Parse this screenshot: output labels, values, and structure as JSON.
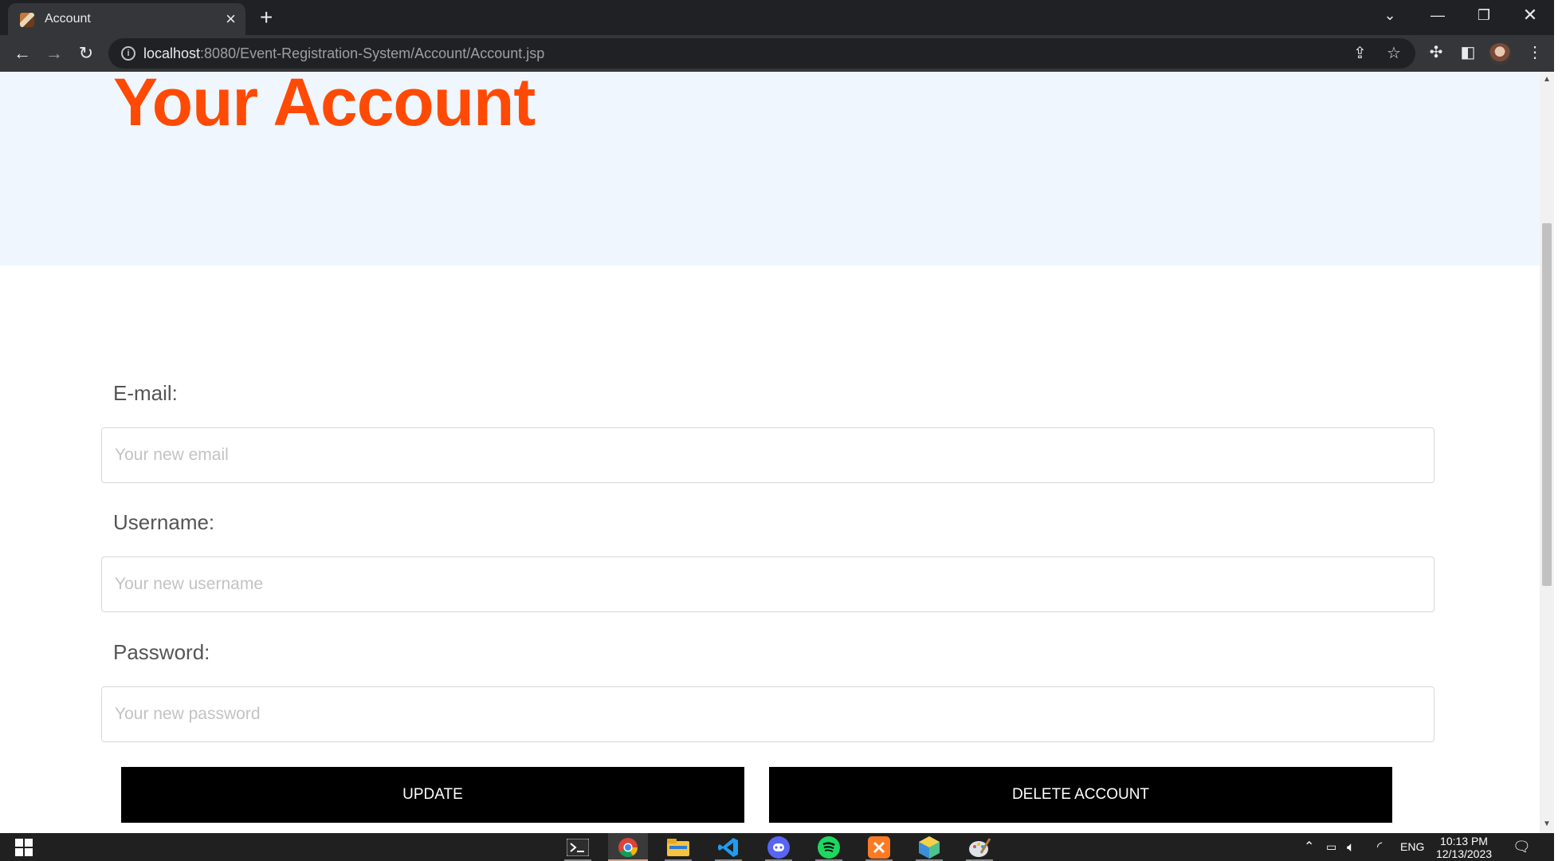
{
  "browser": {
    "tab_title": "Account",
    "new_tab_symbol": "+",
    "url_host": "localhost",
    "url_rest": ":8080/Event-Registration-System/Account/Account.jsp"
  },
  "page": {
    "heading": "Your Account",
    "email": {
      "label": "E-mail:",
      "placeholder": "Your new email",
      "value": ""
    },
    "username": {
      "label": "Username:",
      "placeholder": "Your new username",
      "value": ""
    },
    "password": {
      "label": "Password:",
      "placeholder": "Your new password",
      "value": ""
    },
    "update_button": "UPDATE",
    "delete_button": "DELETE ACCOUNT"
  },
  "taskbar": {
    "apps": [
      "terminal-icon",
      "chrome-icon",
      "file-explorer-icon",
      "vscode-icon",
      "discord-icon",
      "spotify-icon",
      "xampp-icon",
      "app-icon",
      "paint-icon"
    ],
    "language": "ENG",
    "time": "10:13 PM",
    "date": "12/13/2023"
  },
  "colors": {
    "heading": "#ff4a05",
    "hero_background": "#eff6fd",
    "button_background": "#000000",
    "chrome_dark": "#202124"
  }
}
